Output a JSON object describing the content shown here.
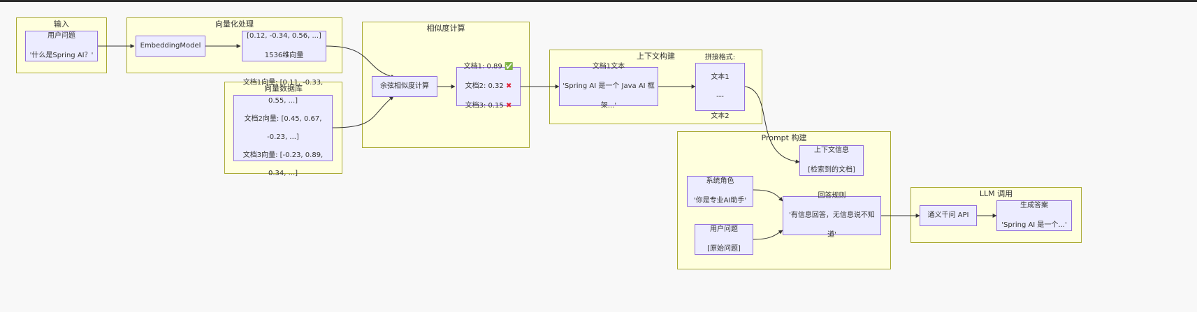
{
  "clusters": {
    "input": "输入",
    "vectorize": "向量化处理",
    "vectordb": "向量数据库",
    "similarity": "相似度计算",
    "context": "上下文构建",
    "prompt": "Prompt 构建",
    "llm": "LLM 调用"
  },
  "nodes": {
    "user_question": [
      "用户问题",
      "'什么是Spring AI？'"
    ],
    "embedding_model": [
      "EmbeddingModel"
    ],
    "vector_out": [
      "[0.12, -0.34, 0.56, ...]",
      "1536维向量"
    ],
    "db_vectors": [
      "文档1向量: [0.11, -0.33,",
      "0.55, ...]",
      "文档2向量: [0.45, 0.67,",
      "-0.23, ...]",
      "文档3向量: [-0.23, 0.89,",
      "0.34, ...]"
    ],
    "cosine": [
      "余弦相似度计算"
    ],
    "scores": [
      {
        "text": "文档1: 0.89",
        "mark": "✅",
        "status": "ok"
      },
      {
        "text": "文档2: 0.32",
        "mark": "✖",
        "status": "no"
      },
      {
        "text": "文档3: 0.15",
        "mark": "✖",
        "status": "no"
      }
    ],
    "doc_text": [
      "文档1文本",
      "'Spring AI 是一个 Java AI 框",
      "架...'"
    ],
    "concat_format": [
      "拼接格式:",
      "文本1",
      "---",
      "文本2"
    ],
    "context_info": [
      "上下文信息",
      "[检索到的文档]"
    ],
    "system_role": [
      "系统角色",
      "'你是专业AI助手'"
    ],
    "answer_rules": [
      "回答规则",
      "'有信息回答，无信息说不知",
      "道'"
    ],
    "user_question_raw": [
      "用户问题",
      "[原始问题]"
    ],
    "tongyi_api": [
      "通义千问 API"
    ],
    "generate_answer": [
      "生成答案",
      "'Spring AI 是一个...'"
    ]
  },
  "colors": {
    "cluster_fill": "#ffffde",
    "cluster_border": "#aaaa33",
    "node_fill": "#ececff",
    "node_border": "#9370db",
    "edge": "#333333"
  }
}
